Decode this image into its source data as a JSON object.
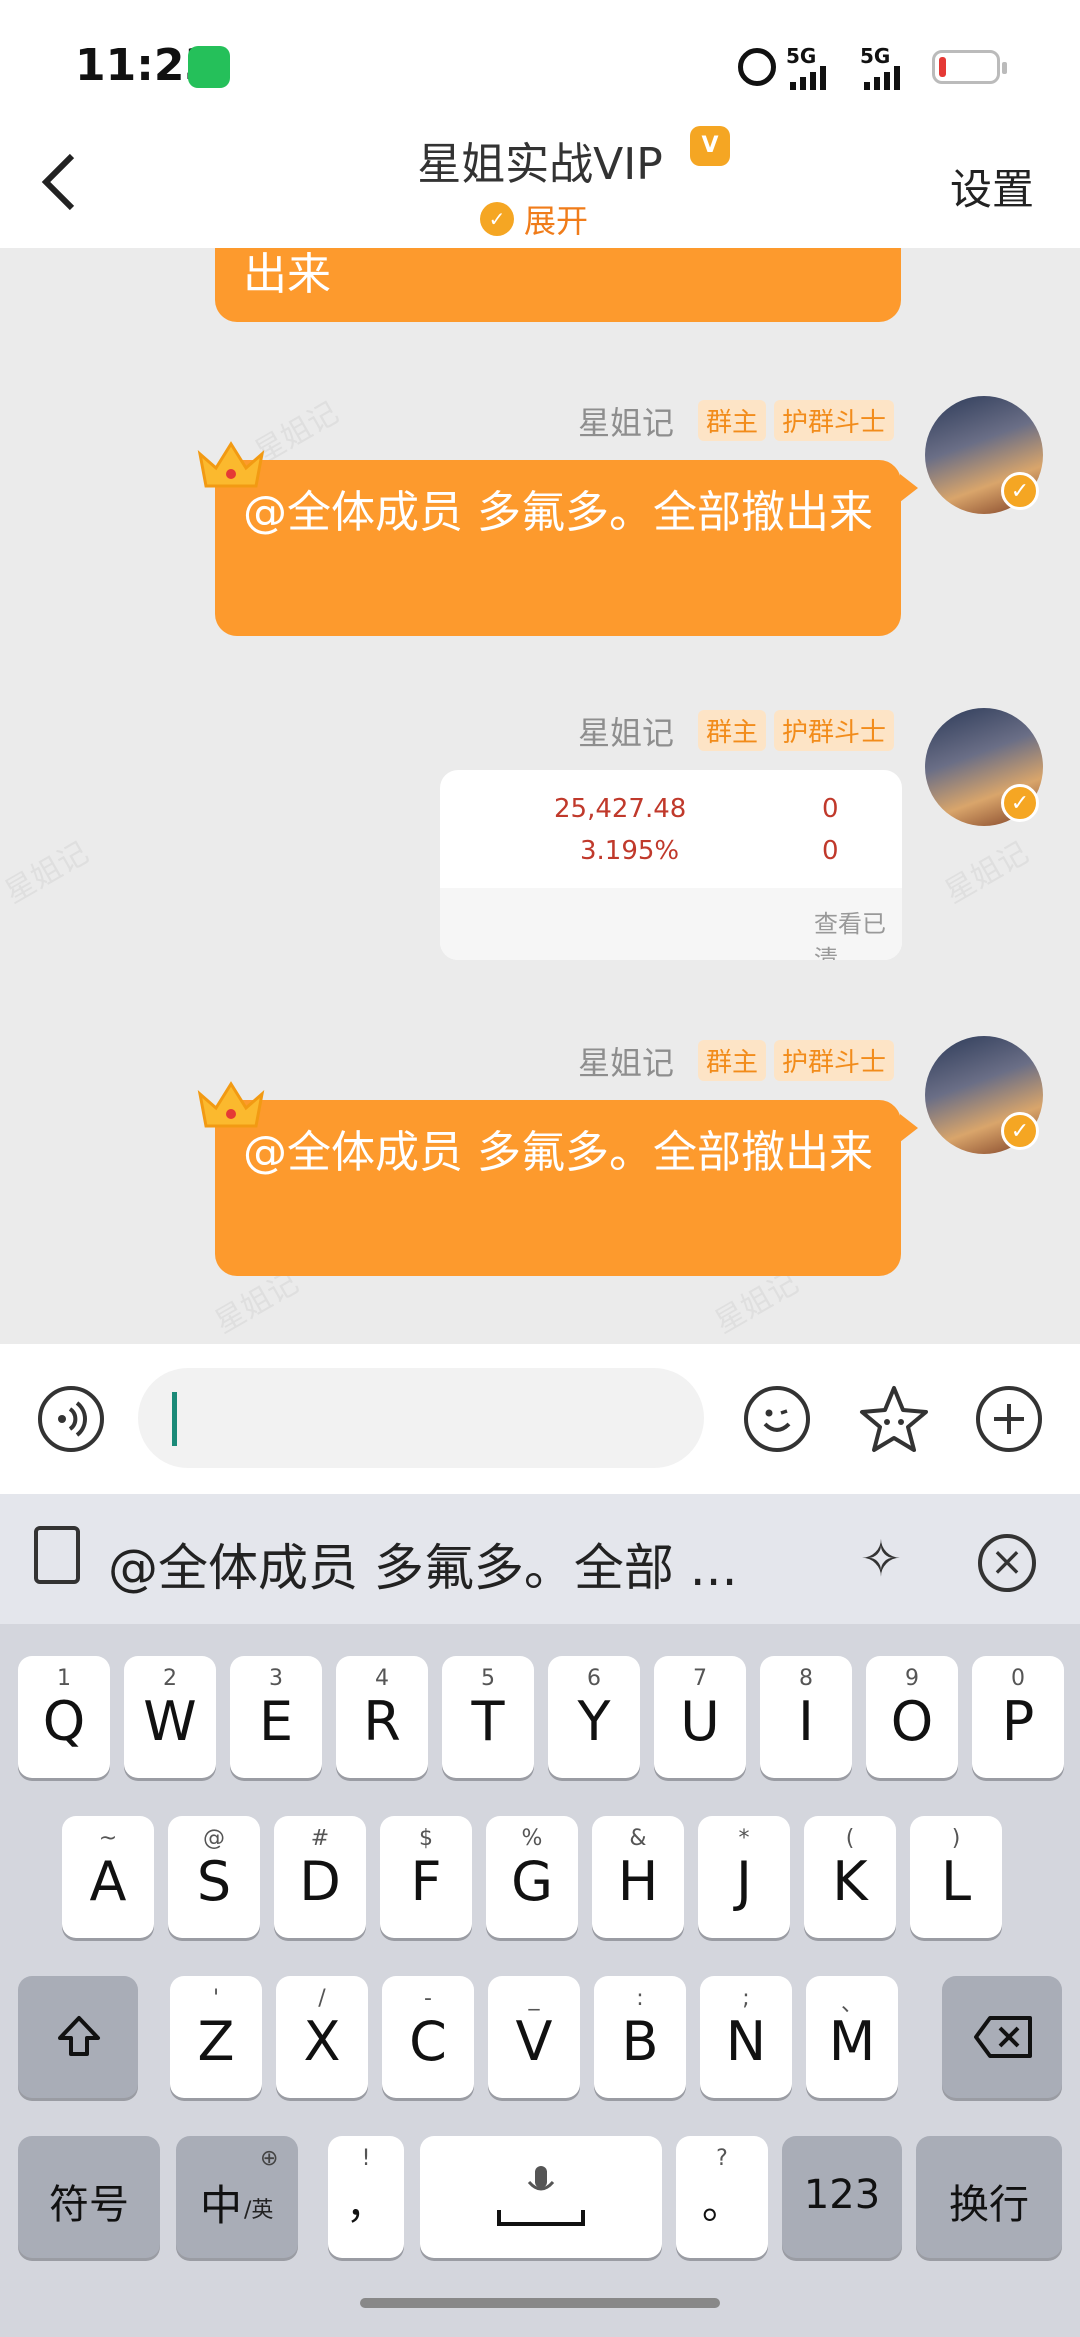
{
  "status_bar": {
    "time": "11:23",
    "network1": "5G",
    "network2": "5G"
  },
  "header": {
    "back": "<",
    "title": "星姐实战VIP",
    "vip_badge": "V",
    "expand_label": "展开",
    "settings": "设置"
  },
  "messages": [
    {
      "text_line2": "出来"
    },
    {
      "sender": "星姐记",
      "tag1": "群主",
      "tag2": "护群斗士",
      "text": "@全体成员  多氟多。全部撤出来"
    },
    {
      "sender": "星姐记",
      "tag1": "群主",
      "tag2": "护群斗士",
      "card": {
        "row1_value": "25,427.48",
        "row1_right": "0",
        "row2_value": "3.195%",
        "row2_right": "0",
        "footer": "查看已清"
      }
    },
    {
      "sender": "星姐记",
      "tag1": "群主",
      "tag2": "护群斗士",
      "text": "@全体成员  多氟多。全部撤出来"
    }
  ],
  "watermark": "星姐记",
  "input": {
    "placeholder": ""
  },
  "suggestion": {
    "text": "@全体成员  多氟多。全部 ..."
  },
  "keyboard": {
    "row1": [
      {
        "k": "Q",
        "h": "1"
      },
      {
        "k": "W",
        "h": "2"
      },
      {
        "k": "E",
        "h": "3"
      },
      {
        "k": "R",
        "h": "4"
      },
      {
        "k": "T",
        "h": "5"
      },
      {
        "k": "Y",
        "h": "6"
      },
      {
        "k": "U",
        "h": "7"
      },
      {
        "k": "I",
        "h": "8"
      },
      {
        "k": "O",
        "h": "9"
      },
      {
        "k": "P",
        "h": "0"
      }
    ],
    "row2": [
      {
        "k": "A",
        "h": "~"
      },
      {
        "k": "S",
        "h": "@"
      },
      {
        "k": "D",
        "h": "#"
      },
      {
        "k": "F",
        "h": "$"
      },
      {
        "k": "G",
        "h": "%"
      },
      {
        "k": "H",
        "h": "&"
      },
      {
        "k": "J",
        "h": "*"
      },
      {
        "k": "K",
        "h": "("
      },
      {
        "k": "L",
        "h": ")"
      }
    ],
    "row3": [
      {
        "k": "Z",
        "h": "'"
      },
      {
        "k": "X",
        "h": "/"
      },
      {
        "k": "C",
        "h": "-"
      },
      {
        "k": "V",
        "h": "_"
      },
      {
        "k": "B",
        "h": ":"
      },
      {
        "k": "N",
        "h": ";"
      },
      {
        "k": "M",
        "h": "、"
      }
    ],
    "symbols": "符号",
    "lang_main": "中",
    "lang_sub": "/英",
    "comma_hint": "!",
    "comma": "，",
    "period_hint": "?",
    "period": "。",
    "num": "123",
    "enter": "换行"
  },
  "colors": {
    "bubble": "#fd9a2d",
    "tag_text": "#f28c1b",
    "accent": "#f5a623"
  }
}
